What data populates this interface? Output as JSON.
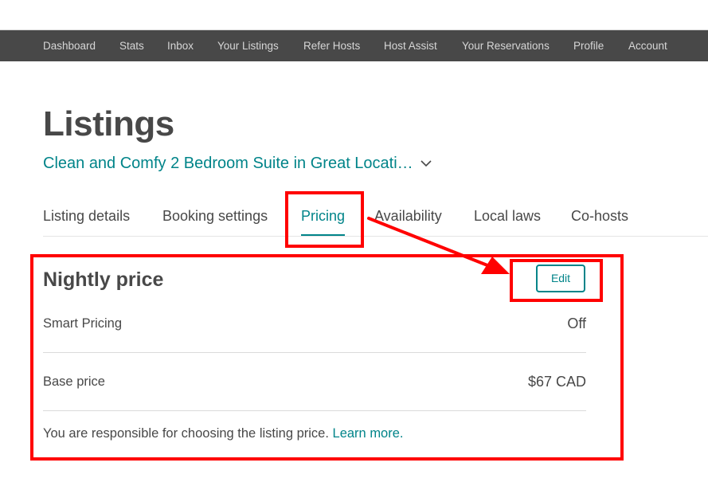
{
  "topnav": {
    "items": [
      {
        "label": "Dashboard"
      },
      {
        "label": "Stats"
      },
      {
        "label": "Inbox"
      },
      {
        "label": "Your Listings"
      },
      {
        "label": "Refer Hosts"
      },
      {
        "label": "Host Assist"
      },
      {
        "label": "Your Reservations"
      },
      {
        "label": "Profile"
      },
      {
        "label": "Account"
      }
    ]
  },
  "page": {
    "title": "Listings",
    "listing_name": "Clean and Comfy 2 Bedroom Suite in Great Locati…",
    "chevron_icon": "chevron-down-icon"
  },
  "tabs": [
    {
      "label": "Listing details",
      "active": false
    },
    {
      "label": "Booking settings",
      "active": false
    },
    {
      "label": "Pricing",
      "active": true
    },
    {
      "label": "Availability",
      "active": false
    },
    {
      "label": "Local laws",
      "active": false
    },
    {
      "label": "Co-hosts",
      "active": false
    }
  ],
  "nightly_price": {
    "title": "Nightly price",
    "edit_label": "Edit",
    "rows": [
      {
        "label": "Smart Pricing",
        "value": "Off"
      },
      {
        "label": "Base price",
        "value": "$67 CAD"
      }
    ],
    "note_text": "You are responsible for choosing the listing price. ",
    "note_link": "Learn more."
  },
  "colors": {
    "accent": "#008489",
    "nav_bg": "#484848",
    "text": "#484848",
    "annotation": "#ff0000"
  }
}
